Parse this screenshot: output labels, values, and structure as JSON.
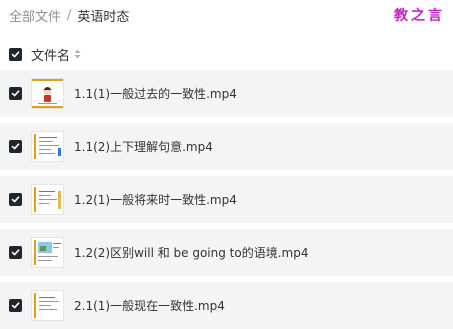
{
  "breadcrumb": {
    "root": "全部文件",
    "separator": "/",
    "current": "英语时态"
  },
  "watermark": "教之言",
  "file_list": {
    "header_label": "文件名",
    "files": [
      {
        "name": "1.1(1)一般过去的一致性.mp4",
        "checked": true
      },
      {
        "name": "1.1(2)上下理解句意.mp4",
        "checked": true
      },
      {
        "name": "1.2(1)一般将来时一致性.mp4",
        "checked": true
      },
      {
        "name": "1.2(2)区别will 和 be going to的语境.mp4",
        "checked": true
      },
      {
        "name": "2.1(1)一般现在一致性.mp4",
        "checked": true
      }
    ]
  },
  "colors": {
    "checkbox": "#1f2630",
    "row_background": "#f4f4f4",
    "watermark": "#c425c4",
    "thumb_accent": "#d9a21c"
  }
}
